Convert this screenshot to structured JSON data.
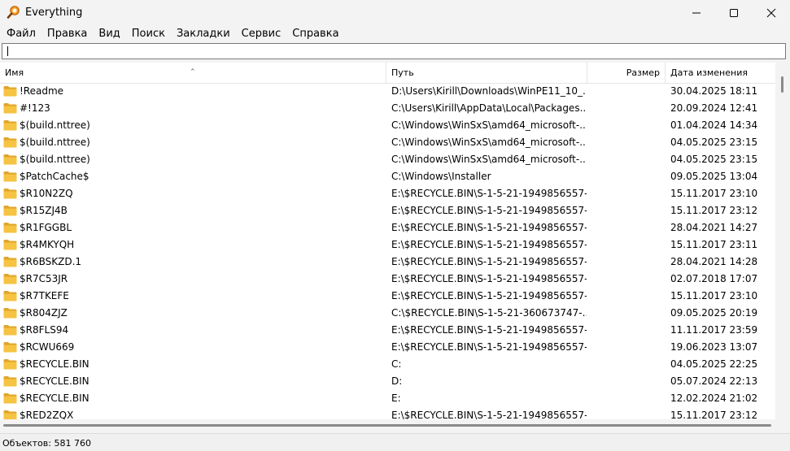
{
  "window": {
    "title": "Everything"
  },
  "menu": [
    "Файл",
    "Правка",
    "Вид",
    "Поиск",
    "Закладки",
    "Сервис",
    "Справка"
  ],
  "search": {
    "value": "",
    "placeholder": ""
  },
  "columns": {
    "name": "Имя",
    "path": "Путь",
    "size": "Размер",
    "date": "Дата изменения"
  },
  "rows": [
    {
      "name": "!Readme",
      "path": "D:\\Users\\Kirill\\Downloads\\WinPE11_10_...",
      "date": "30.04.2025 18:11"
    },
    {
      "name": "#!123",
      "path": "C:\\Users\\Kirill\\AppData\\Local\\Packages...",
      "date": "20.09.2024 12:41"
    },
    {
      "name": "$(build.nttree)",
      "path": "C:\\Windows\\WinSxS\\amd64_microsoft-...",
      "date": "01.04.2024 14:34"
    },
    {
      "name": "$(build.nttree)",
      "path": "C:\\Windows\\WinSxS\\amd64_microsoft-...",
      "date": "04.05.2025 23:15"
    },
    {
      "name": "$(build.nttree)",
      "path": "C:\\Windows\\WinSxS\\amd64_microsoft-...",
      "date": "04.05.2025 23:15"
    },
    {
      "name": "$PatchCache$",
      "path": "C:\\Windows\\Installer",
      "date": "09.05.2025 13:04"
    },
    {
      "name": "$R10N2ZQ",
      "path": "E:\\$RECYCLE.BIN\\S-1-5-21-1949856557-...",
      "date": "15.11.2017 23:10"
    },
    {
      "name": "$R15ZJ4B",
      "path": "E:\\$RECYCLE.BIN\\S-1-5-21-1949856557-...",
      "date": "15.11.2017 23:12"
    },
    {
      "name": "$R1FGGBL",
      "path": "E:\\$RECYCLE.BIN\\S-1-5-21-1949856557-...",
      "date": "28.04.2021 14:27"
    },
    {
      "name": "$R4MKYQH",
      "path": "E:\\$RECYCLE.BIN\\S-1-5-21-1949856557-...",
      "date": "15.11.2017 23:11"
    },
    {
      "name": "$R6BSKZD.1",
      "path": "E:\\$RECYCLE.BIN\\S-1-5-21-1949856557-...",
      "date": "28.04.2021 14:28"
    },
    {
      "name": "$R7C53JR",
      "path": "E:\\$RECYCLE.BIN\\S-1-5-21-1949856557-...",
      "date": "02.07.2018 17:07"
    },
    {
      "name": "$R7TKEFE",
      "path": "E:\\$RECYCLE.BIN\\S-1-5-21-1949856557-...",
      "date": "15.11.2017 23:10"
    },
    {
      "name": "$R804ZJZ",
      "path": "C:\\$RECYCLE.BIN\\S-1-5-21-360673747-...",
      "date": "09.05.2025 20:19"
    },
    {
      "name": "$R8FLS94",
      "path": "E:\\$RECYCLE.BIN\\S-1-5-21-1949856557-...",
      "date": "11.11.2017 23:59"
    },
    {
      "name": "$RCWU669",
      "path": "E:\\$RECYCLE.BIN\\S-1-5-21-1949856557-...",
      "date": "19.06.2023 13:07"
    },
    {
      "name": "$RECYCLE.BIN",
      "path": "C:",
      "date": "04.05.2025 22:25"
    },
    {
      "name": "$RECYCLE.BIN",
      "path": "D:",
      "date": "05.07.2024 22:13"
    },
    {
      "name": "$RECYCLE.BIN",
      "path": "E:",
      "date": "12.02.2024 21:02"
    },
    {
      "name": "$RED2ZQX",
      "path": "E:\\$RECYCLE.BIN\\S-1-5-21-1949856557-...",
      "date": "15.11.2017 23:12"
    }
  ],
  "status": {
    "objects": "Объектов: 581 760"
  },
  "colors": {
    "folder": "#f6c342",
    "folder_dark": "#e0a52a",
    "accent": "#0078d4"
  }
}
